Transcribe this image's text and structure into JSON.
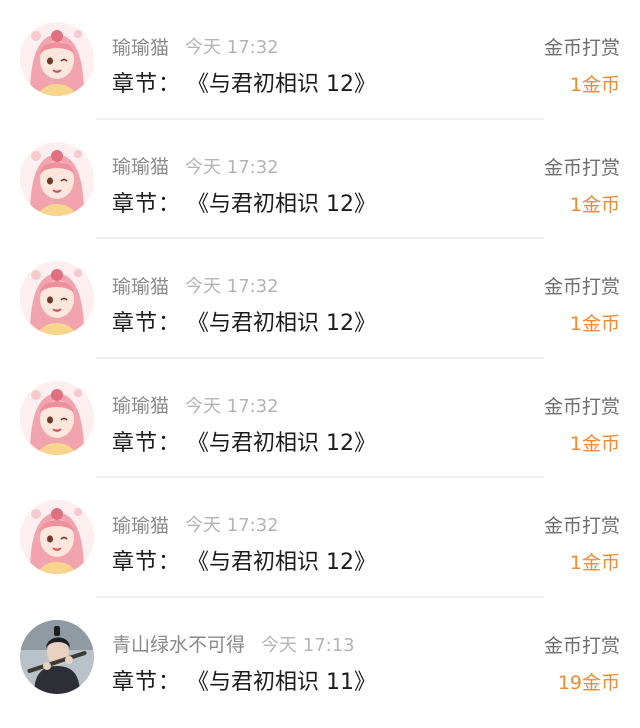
{
  "colors": {
    "username": "#8a8a8a",
    "time": "#b4b4b4",
    "chapter": "#1c1c1c",
    "reward_type": "#6e6e6e",
    "reward_amount": "#f08a33"
  },
  "items": [
    {
      "avatar": "anime-girl-avatar",
      "username": "瑜瑜猫",
      "time": "今天 17:32",
      "chapter_label": "章节：",
      "chapter_title": "《与君初相识 12》",
      "reward_type": "金币打赏",
      "reward_amount": "1金币"
    },
    {
      "avatar": "anime-girl-avatar",
      "username": "瑜瑜猫",
      "time": "今天 17:32",
      "chapter_label": "章节：",
      "chapter_title": "《与君初相识 12》",
      "reward_type": "金币打赏",
      "reward_amount": "1金币"
    },
    {
      "avatar": "anime-girl-avatar",
      "username": "瑜瑜猫",
      "time": "今天 17:32",
      "chapter_label": "章节：",
      "chapter_title": "《与君初相识 12》",
      "reward_type": "金币打赏",
      "reward_amount": "1金币"
    },
    {
      "avatar": "anime-girl-avatar",
      "username": "瑜瑜猫",
      "time": "今天 17:32",
      "chapter_label": "章节：",
      "chapter_title": "《与君初相识 12》",
      "reward_type": "金币打赏",
      "reward_amount": "1金币"
    },
    {
      "avatar": "anime-girl-avatar",
      "username": "瑜瑜猫",
      "time": "今天 17:32",
      "chapter_label": "章节：",
      "chapter_title": "《与君初相识 12》",
      "reward_type": "金币打赏",
      "reward_amount": "1金币"
    },
    {
      "avatar": "man-with-flute-avatar",
      "username": "青山绿水不可得",
      "time": "今天 17:13",
      "chapter_label": "章节：",
      "chapter_title": "《与君初相识 11》",
      "reward_type": "金币打赏",
      "reward_amount": "19金币"
    }
  ]
}
